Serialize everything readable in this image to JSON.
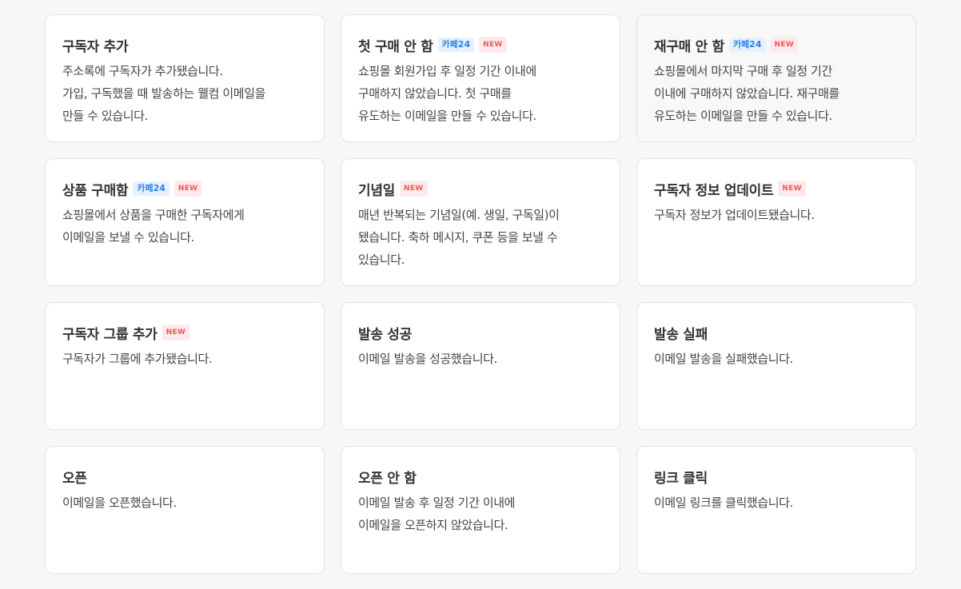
{
  "badges": {
    "cafe24": "카페24",
    "new": "NEW"
  },
  "cards": [
    {
      "title": "구독자 추가",
      "lines": [
        "주소록에 구독자가 추가됐습니다.",
        "가입, 구독했을 때 발송하는 웰컴 이메일을",
        "만들 수 있습니다."
      ]
    },
    {
      "title": "첫 구매 안 함",
      "lines": [
        "쇼핑몰 회원가입 후 일정 기간 이내에",
        "구매하지 않았습니다. 첫 구매를",
        "유도하는 이메일을 만들 수 있습니다."
      ]
    },
    {
      "title": "재구매 안 함",
      "lines": [
        "쇼핑몰에서 마지막 구매 후 일정 기간",
        "이내에 구매하지 않았습니다. 재구매를",
        "유도하는 이메일을 만들 수 있습니다."
      ]
    },
    {
      "title": "상품 구매함",
      "lines": [
        "쇼핑몰에서 상품을 구매한 구독자에게",
        "이메일을 보낼 수 있습니다."
      ]
    },
    {
      "title": "기념일",
      "lines": [
        "매년 반복되는 기념일(예. 생일, 구독일)이",
        "됐습니다. 축하 메시지, 쿠폰 등을 보낼 수",
        "있습니다."
      ]
    },
    {
      "title": "구독자 정보 업데이트",
      "lines": [
        "구독자 정보가 업데이트됐습니다."
      ]
    },
    {
      "title": "구독자 그룹 추가",
      "lines": [
        "구독자가 그룹에 추가됐습니다."
      ]
    },
    {
      "title": "발송 성공",
      "lines": [
        "이메일 발송을 성공했습니다."
      ]
    },
    {
      "title": "발송 실패",
      "lines": [
        "이메일 발송을 실패했습니다."
      ]
    },
    {
      "title": "오픈",
      "lines": [
        "이메일을 오픈했습니다."
      ]
    },
    {
      "title": "오픈 안 함",
      "lines": [
        "이메일 발송 후 일정 기간 이내에",
        "이메일을 오픈하지 않았습니다."
      ]
    },
    {
      "title": "링크 클릭",
      "lines": [
        "이메일 링크를 클릭했습니다."
      ]
    }
  ]
}
